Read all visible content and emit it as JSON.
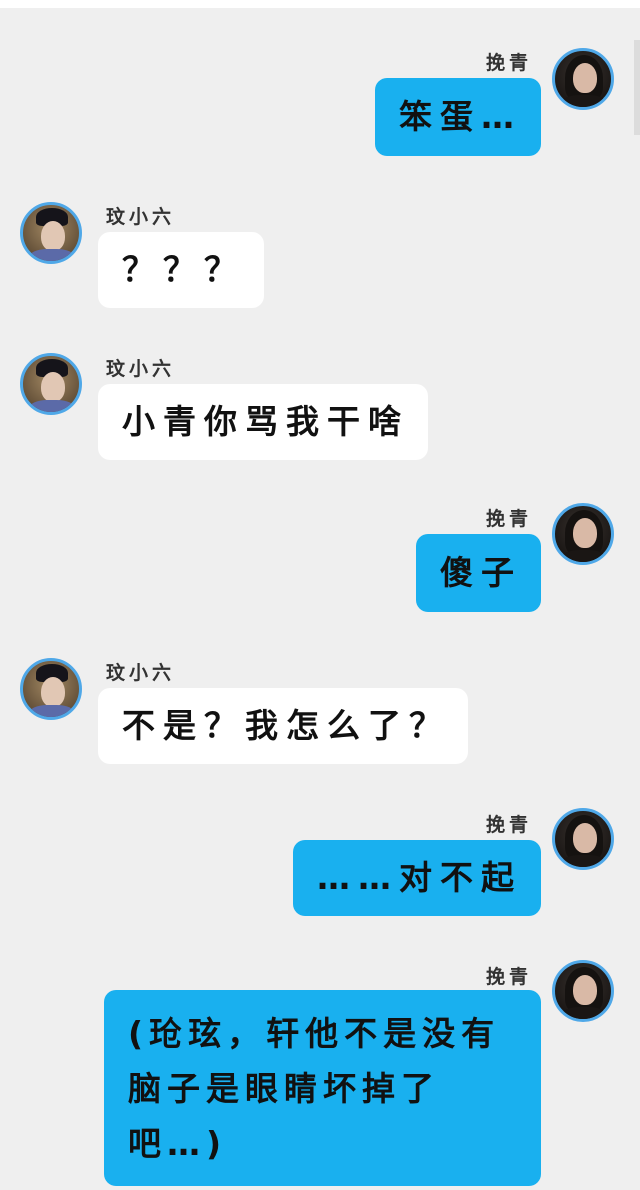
{
  "colors": {
    "background": "#efefef",
    "sent_bubble": "#19b0ef",
    "received_bubble": "#ffffff",
    "avatar_ring": "#4fa8e8"
  },
  "messages": [
    {
      "side": "right",
      "sender": "挽青",
      "text": "笨蛋…"
    },
    {
      "side": "left",
      "sender": "玟小六",
      "text": "？？？"
    },
    {
      "side": "left",
      "sender": "玟小六",
      "text": "小青你骂我干啥"
    },
    {
      "side": "right",
      "sender": "挽青",
      "text": "傻子"
    },
    {
      "side": "left",
      "sender": "玟小六",
      "text": "不是？我怎么了？"
    },
    {
      "side": "right",
      "sender": "挽青",
      "text": "……对不起"
    },
    {
      "side": "right",
      "sender": "挽青",
      "text": "(玱玹，轩他不是没有脑子是眼睛坏掉了吧…)"
    }
  ]
}
